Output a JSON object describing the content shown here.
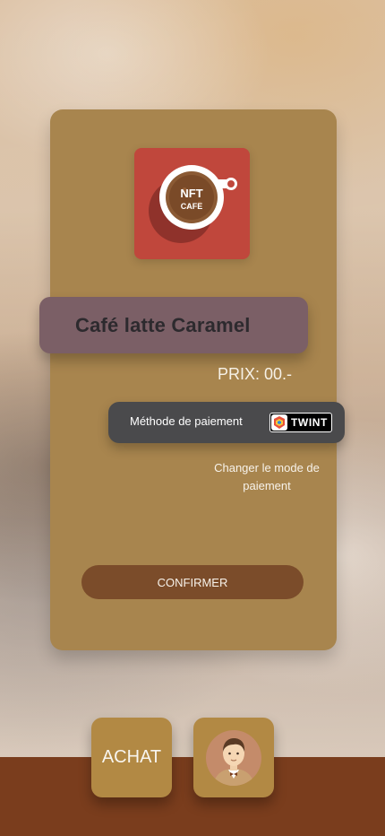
{
  "app": {
    "logo_text_line1": "NFT",
    "logo_text_line2": "CAFE"
  },
  "product": {
    "name": "Café latte Caramel",
    "price": "PRIX: 00.-"
  },
  "payment": {
    "label": "Méthode de paiement",
    "method_badge": "TWINT",
    "change_link": "Changer le mode de paiement"
  },
  "actions": {
    "confirm": "CONFIRMER"
  },
  "bottom_nav": {
    "achat_label": "ACHAT",
    "profile_icon": "avatar-icon"
  },
  "colors": {
    "card": "#a8854e",
    "title_pill": "#7b5f66",
    "payment_pill": "#4a4a4c",
    "confirm_button": "#7b4c2a",
    "bottom_bar": "#7a3d1d",
    "nav_tile": "#b28944",
    "logo_tile": "#c0473c"
  }
}
